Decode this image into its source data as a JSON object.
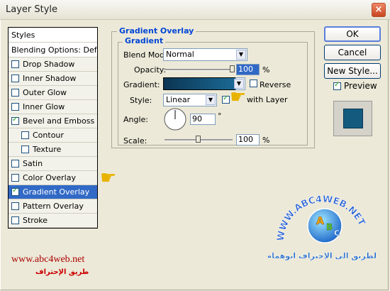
{
  "window": {
    "title": "Layer Style",
    "close_symbol": "×"
  },
  "styles_list": {
    "items": [
      {
        "label": "Styles",
        "type": "header"
      },
      {
        "label": "Blending Options: Default",
        "type": "header"
      },
      {
        "label": "Drop Shadow",
        "checked": false
      },
      {
        "label": "Inner Shadow",
        "checked": false
      },
      {
        "label": "Outer Glow",
        "checked": false
      },
      {
        "label": "Inner Glow",
        "checked": false
      },
      {
        "label": "Bevel and Emboss",
        "checked": true
      },
      {
        "label": "Contour",
        "checked": false,
        "sub": true
      },
      {
        "label": "Texture",
        "checked": false,
        "sub": true
      },
      {
        "label": "Satin",
        "checked": false
      },
      {
        "label": "Color Overlay",
        "checked": false
      },
      {
        "label": "Gradient Overlay",
        "checked": true,
        "selected": true
      },
      {
        "label": "Pattern Overlay",
        "checked": false
      },
      {
        "label": "Stroke",
        "checked": false
      }
    ]
  },
  "panel": {
    "title": "Gradient Overlay",
    "group_title": "Gradient",
    "blend_mode": {
      "label": "Blend Mode:",
      "value": "Normal"
    },
    "opacity": {
      "label": "Opacity:",
      "value": "100",
      "unit": "%",
      "level": 1.0
    },
    "gradient": {
      "label": "Gradient:",
      "color_start": "#0b3553",
      "color_end": "#1b6a95"
    },
    "reverse": {
      "label": "Reverse",
      "checked": false
    },
    "style": {
      "label": "Style:",
      "value": "Linear"
    },
    "align": {
      "label": "with Layer",
      "checked": true
    },
    "angle": {
      "label": "Angle:",
      "value": "90",
      "unit": "°"
    },
    "scale": {
      "label": "Scale:",
      "value": "100",
      "unit": "%",
      "level": 0.5
    }
  },
  "buttons": {
    "ok": "OK",
    "cancel": "Cancel",
    "new_style": "New Style...",
    "preview_label": "Preview",
    "preview_checked": true,
    "preview_color": "#145a7f"
  },
  "watermark": {
    "url": "www.abc4web.net",
    "tagline": "طريق الإحتراف",
    "logo_text": "WWW.ABC4WEB.NET",
    "logo_arabic": "الطريق الى الإحتراف ابوهمام"
  }
}
